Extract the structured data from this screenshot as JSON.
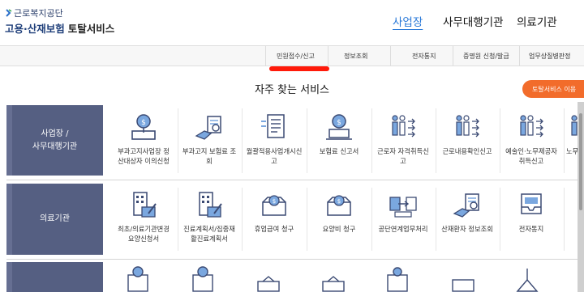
{
  "header": {
    "org_name": "근로복지공단",
    "portal_name": "고용·산재보험",
    "portal_suffix": "토탈서비스",
    "nav": [
      "사업장",
      "사무대행기관",
      "의료기관"
    ]
  },
  "submenu": [
    "민원접수/신고",
    "정보조회",
    "전자통지",
    "증명원 신청/발급",
    "업무상질병판정"
  ],
  "section_title": "자주 찾는 서비스",
  "portal_button": "토탈서비스 이용",
  "categories": [
    {
      "label_line1": "사업장 /",
      "label_line2": "사무대행기관",
      "services": [
        {
          "icon": "document-coin-icon",
          "line1": "부과고지사업장 정",
          "line2": "산대상자 이의신청"
        },
        {
          "icon": "hand-document-search-icon",
          "line1": "부과고지 보험료 조",
          "line2": "회"
        },
        {
          "icon": "document-list-icon",
          "line1": "월괄적용사업개시신",
          "line2": "고"
        },
        {
          "icon": "monitor-coin-icon",
          "line1": "보험료 신고서",
          "line2": ""
        },
        {
          "icon": "people-arrows-icon",
          "line1": "근로자 자격취득신",
          "line2": "고"
        },
        {
          "icon": "people-arrows-icon",
          "line1": "근로내용확인신고",
          "line2": ""
        },
        {
          "icon": "people-arrows-icon",
          "line1": "예술인·노무제공자",
          "line2": "취득신고"
        },
        {
          "icon": "people-arrows-icon",
          "line1": "노무",
          "line2": ""
        }
      ]
    },
    {
      "label_line1": "의료기관",
      "label_line2": "",
      "services": [
        {
          "icon": "building-pen-icon",
          "line1": "최초/의료기관변경",
          "line2": "요양신청서"
        },
        {
          "icon": "building-pen-icon",
          "line1": "진료계획서/집중재",
          "line2": "활진료계획서"
        },
        {
          "icon": "box-coin-icon",
          "line1": "휴업급여 청구",
          "line2": ""
        },
        {
          "icon": "box-coin-icon",
          "line1": "요양비 청구",
          "line2": ""
        },
        {
          "icon": "transfer-icon",
          "line1": "공단연계업무처리",
          "line2": ""
        },
        {
          "icon": "hand-document-search-icon",
          "line1": "산재환자 정보조회",
          "line2": ""
        },
        {
          "icon": "inbox-notice-icon",
          "line1": "전자통지",
          "line2": ""
        }
      ]
    }
  ],
  "colors": {
    "accent_blue": "#2878d8",
    "category_bg": "#555f82",
    "icon_stroke": "#3b4a73",
    "icon_fill": "#7aa7df",
    "button_orange": "#f26c2b",
    "active_red": "#ff1a0a"
  }
}
